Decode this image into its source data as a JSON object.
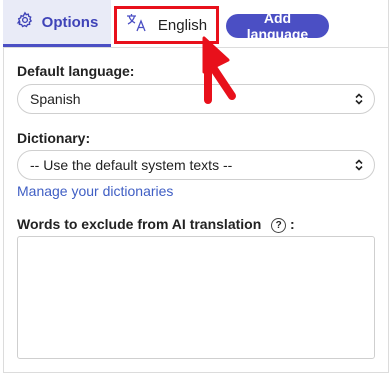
{
  "tabs": {
    "options_label": "Options",
    "english_label": "English",
    "add_language_label": "Add language"
  },
  "default_language": {
    "label": "Default language:",
    "value": "Spanish"
  },
  "dictionary": {
    "label": "Dictionary:",
    "value": "-- Use the default system texts --",
    "manage_link": "Manage your dictionaries"
  },
  "exclude_words": {
    "label": "Words to exclude from AI translation",
    "help_glyph": "?",
    "suffix": ":"
  },
  "colors": {
    "accent": "#4b4fc4",
    "highlight": "#e8101b",
    "link": "#3f5ec4"
  },
  "icons": [
    "gear-icon",
    "translate-icon",
    "select-arrows-icon",
    "help-icon",
    "red-arrow-annotation"
  ]
}
